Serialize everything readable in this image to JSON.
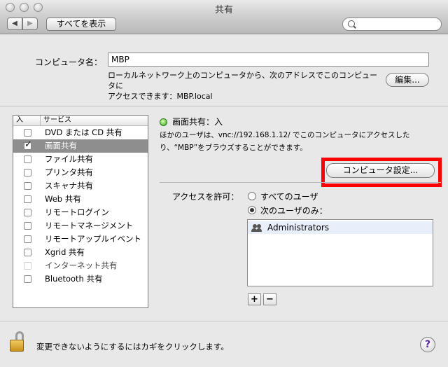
{
  "window": {
    "title": "共有"
  },
  "toolbar": {
    "back": "◀",
    "forward": "▶",
    "show_all": "すべてを表示",
    "search_placeholder": ""
  },
  "computer_name": {
    "label": "コンピュータ名：",
    "value": "MBP",
    "note_line1": "ローカルネットワーク上のコンピュータから、次のアドレスでこのコンピュータに",
    "note_line2": "アクセスできます：MBP.local",
    "edit_button": "編集..."
  },
  "services": {
    "header_on": "入",
    "header_service": "サービス",
    "items": [
      {
        "name": "DVD または CD 共有",
        "checked": false,
        "selected": false,
        "dim": false
      },
      {
        "name": "画面共有",
        "checked": true,
        "selected": true,
        "dim": false
      },
      {
        "name": "ファイル共有",
        "checked": false,
        "selected": false,
        "dim": false
      },
      {
        "name": "プリンタ共有",
        "checked": false,
        "selected": false,
        "dim": false
      },
      {
        "name": "スキャナ共有",
        "checked": false,
        "selected": false,
        "dim": false
      },
      {
        "name": "Web 共有",
        "checked": false,
        "selected": false,
        "dim": false
      },
      {
        "name": "リモートログイン",
        "checked": false,
        "selected": false,
        "dim": false
      },
      {
        "name": "リモートマネージメント",
        "checked": false,
        "selected": false,
        "dim": false
      },
      {
        "name": "リモートアップルイベント",
        "checked": false,
        "selected": false,
        "dim": false
      },
      {
        "name": "Xgrid 共有",
        "checked": false,
        "selected": false,
        "dim": false
      },
      {
        "name": "インターネット共有",
        "checked": false,
        "selected": false,
        "dim": true
      },
      {
        "name": "Bluetooth 共有",
        "checked": false,
        "selected": false,
        "dim": false
      }
    ]
  },
  "detail": {
    "status": "画面共有：入",
    "status_color": "#33a81c",
    "desc_line1": "ほかのユーザは、vnc://192.168.1.12/ でこのコンピュータにアクセスした",
    "desc_line2": "り、“MBP”をブラウズすることができます。",
    "settings_button": "コンピュータ設定...",
    "highlight_color": "#ff0000",
    "access_label": "アクセスを許可：",
    "radio_all": "すべてのユーザ",
    "radio_only": "次のユーザのみ：",
    "users": [
      "Administrators"
    ],
    "add": "+",
    "remove": "−"
  },
  "footer": {
    "lock_text": "変更できないようにするにはカギをクリックします。",
    "help": "?"
  }
}
